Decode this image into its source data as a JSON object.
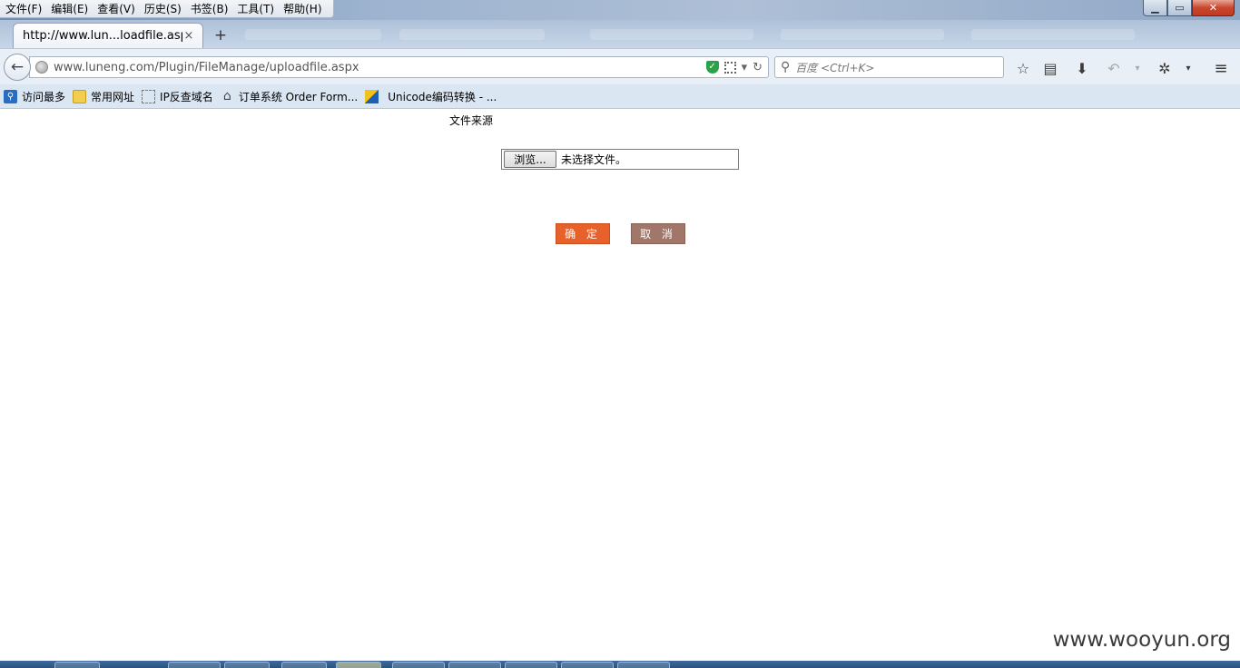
{
  "menubar": {
    "items": [
      "文件(F)",
      "编辑(E)",
      "查看(V)",
      "历史(S)",
      "书签(B)",
      "工具(T)",
      "帮助(H)"
    ]
  },
  "tab": {
    "title": "http://www.lun...loadfile.aspx",
    "close_glyph": "×",
    "new_tab_glyph": "+"
  },
  "navbar": {
    "url": "www.luneng.com/Plugin/FileManage/uploadfile.aspx",
    "search_placeholder": "百度 <Ctrl+K>"
  },
  "bookmarks": [
    {
      "label": "访问最多",
      "icon": "most-visited-icon"
    },
    {
      "label": "常用网址",
      "icon": "folder-icon"
    },
    {
      "label": "IP反查域名",
      "icon": "page-icon"
    },
    {
      "label": "订单系统 Order Form...",
      "icon": "home-icon"
    },
    {
      "label": "Unicode编码转换 - ...",
      "icon": "unicode-icon"
    }
  ],
  "page": {
    "file_source_label": "文件来源",
    "browse_button": "浏览...",
    "no_file_selected": "未选择文件。",
    "ok_button": "确 定",
    "cancel_button": "取 消"
  },
  "watermark": "www.wooyun.org",
  "colors": {
    "ok_button": "#e8612b",
    "cancel_button": "#a1776a",
    "close_button": "#c8472f"
  }
}
